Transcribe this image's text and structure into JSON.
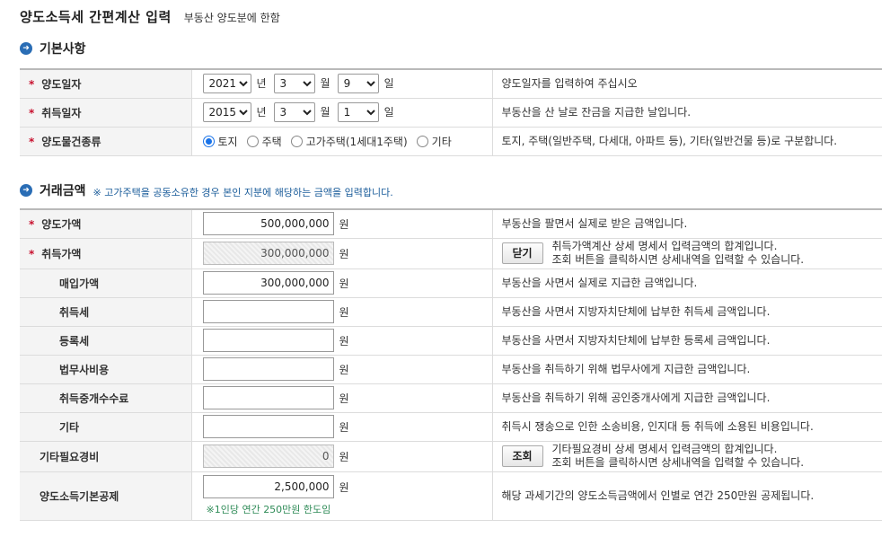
{
  "header": {
    "title": "양도소득세 간편계산 입력",
    "subtitle": "부동산 양도분에 한함"
  },
  "basic": {
    "title": "기본사항",
    "rows": [
      {
        "label": "양도일자",
        "year": "2021",
        "month": "3",
        "day": "9",
        "desc": "양도일자를 입력하여 주십시오"
      },
      {
        "label": "취득일자",
        "year": "2015",
        "month": "3",
        "day": "1",
        "desc": "부동산을 산 날로 잔금을 지급한 날입니다."
      }
    ],
    "units": {
      "year": "년",
      "month": "월",
      "day": "일"
    },
    "type_row": {
      "label": "양도물건종류",
      "options": [
        "토지",
        "주택",
        "고가주택(1세대1주택)",
        "기타"
      ],
      "selected": "토지",
      "desc": "토지, 주택(일반주택, 다세대, 아파트 등), 기타(일반건물 등)로 구분합니다."
    }
  },
  "deal": {
    "title": "거래금액",
    "note": "※ 고가주택을 공동소유한 경우 본인 지분에 해당하는 금액을 입력합니다.",
    "unit": "원",
    "rows": [
      {
        "label": "양도가액",
        "value": "500,000,000",
        "desc": "부동산을 팔면서 실제로 받은 금액입니다."
      },
      {
        "label": "취득가액",
        "value": "300,000,000",
        "button": "닫기",
        "desc1": "취득가액계산 상세 명세서 입력금액의 합계입니다.",
        "desc2": "조회 버튼을 클릭하시면 상세내역을 입력할 수 있습니다."
      },
      {
        "label": "매입가액",
        "value": "300,000,000",
        "desc": "부동산을 사면서 실제로 지급한 금액입니다."
      },
      {
        "label": "취득세",
        "value": "",
        "desc": "부동산을 사면서 지방자치단체에 납부한 취득세 금액입니다."
      },
      {
        "label": "등록세",
        "value": "",
        "desc": "부동산을 사면서 지방자치단체에 납부한 등록세 금액입니다."
      },
      {
        "label": "법무사비용",
        "value": "",
        "desc": "부동산을 취득하기 위해 법무사에게 지급한 금액입니다."
      },
      {
        "label": "취득중개수수료",
        "value": "",
        "desc": "부동산을 취득하기 위해 공인중개사에게 지급한 금액입니다."
      },
      {
        "label": "기타",
        "value": "",
        "desc": "취득시 쟁송으로 인한 소송비용, 인지대 등 취득에 소용된 비용입니다."
      },
      {
        "label": "기타필요경비",
        "value": "0",
        "button": "조회",
        "desc1": "기타필요경비 상세 명세서 입력금액의 합계입니다.",
        "desc2": "조회 버튼을 클릭하시면 상세내역을 입력할 수 있습니다."
      },
      {
        "label": "양도소득기본공제",
        "value": "2,500,000",
        "hint": "※1인당 연간 250만원 한도임",
        "desc": "해당 과세기간의 양도소득금액에서 인별로 연간 250만원 공제됩니다."
      }
    ]
  }
}
